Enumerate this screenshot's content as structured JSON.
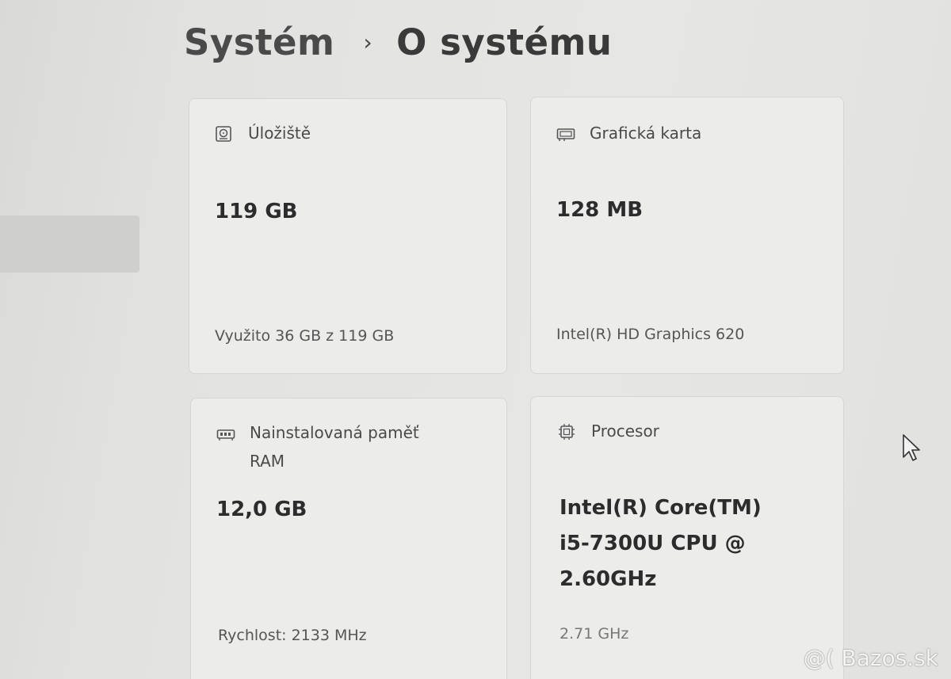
{
  "breadcrumb": {
    "parent": "Systém",
    "separator": "›",
    "current": "O systému"
  },
  "cards": {
    "storage": {
      "icon": "storage-icon",
      "title": "Úložiště",
      "value": "119 GB",
      "detail": "Využito 36 GB z 119 GB"
    },
    "gpu": {
      "icon": "graphics-card-icon",
      "title": "Grafická karta",
      "value": "128 MB",
      "detail": "Intel(R) HD Graphics 620"
    },
    "ram": {
      "icon": "memory-icon",
      "title_line1": "Nainstalovaná paměť",
      "title_line2": "RAM",
      "value": "12,0 GB",
      "detail": "Rychlost: 2133 MHz"
    },
    "cpu": {
      "icon": "processor-icon",
      "title": "Procesor",
      "value_line1": "Intel(R) Core(TM)",
      "value_line2": "i5-7300U CPU @",
      "value_line3": "2.60GHz",
      "detail": "2.71 GHz"
    }
  },
  "watermark": "@( Bazos.sk"
}
